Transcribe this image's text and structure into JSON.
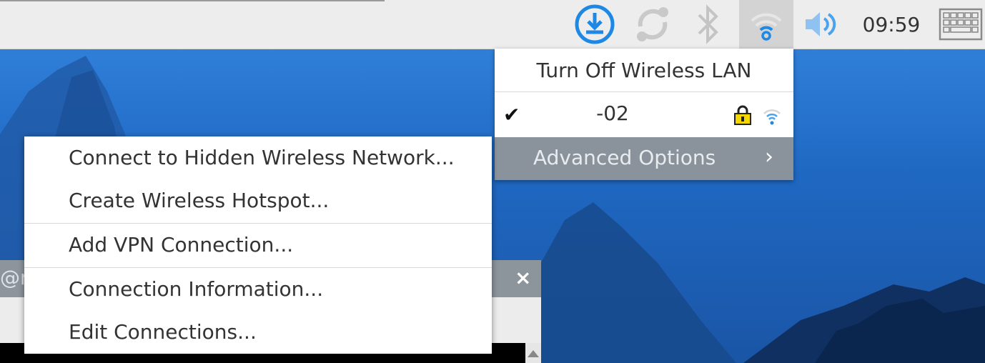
{
  "taskbar": {
    "clock": "09:59",
    "icons": [
      "download-update-icon",
      "sync-icon",
      "bluetooth-icon",
      "wifi-icon",
      "volume-icon",
      "keyboard-icon"
    ],
    "accent_color": "#1e88e5"
  },
  "network_menu": {
    "turn_off_label": "Turn Off Wireless LAN",
    "network": {
      "ssid": "-02",
      "connected": true,
      "secured": true
    },
    "advanced_label": "Advanced Options",
    "advanced_arrow": "›"
  },
  "advanced_menu": {
    "items": [
      "Connect to Hidden Wireless Network...",
      "Create Wireless Hotspot...",
      "Add VPN Connection...",
      "Connection Information...",
      "Edit Connections..."
    ]
  },
  "background_window": {
    "title_fragment": "@r",
    "close_glyph": "×"
  },
  "colors": {
    "taskbar_bg": "#ededed",
    "menu_bg": "#ffffff",
    "highlight_bg": "#8a939c",
    "desktop_bg": "#1f63b5"
  }
}
